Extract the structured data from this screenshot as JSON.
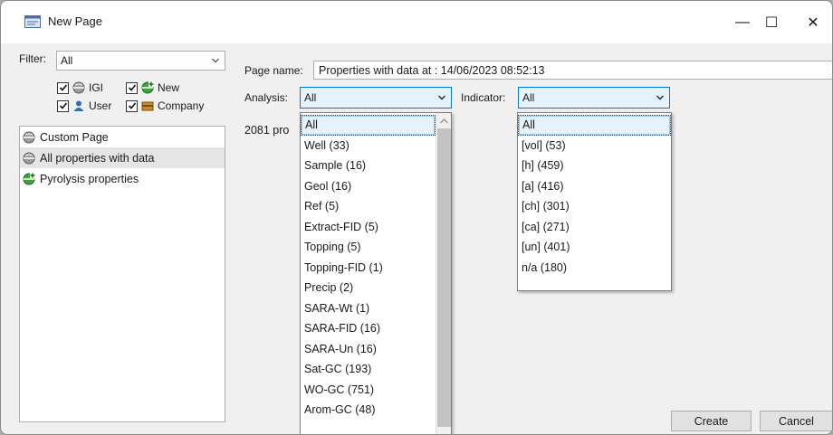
{
  "window": {
    "title": "New Page",
    "minimize_glyph": "—",
    "maximize_glyph": "☐",
    "close_glyph": "✕"
  },
  "filter": {
    "label": "Filter:",
    "value": "All",
    "checkboxes": [
      {
        "label": "IGI",
        "checked": true,
        "icon": "igi-icon"
      },
      {
        "label": "New",
        "checked": true,
        "icon": "new-icon"
      },
      {
        "label": "User",
        "checked": true,
        "icon": "user-icon"
      },
      {
        "label": "Company",
        "checked": true,
        "icon": "company-icon"
      }
    ]
  },
  "templates": {
    "items": [
      {
        "label": "Custom Page",
        "icon": "igi-icon"
      },
      {
        "label": "All properties with data",
        "icon": "igi-icon",
        "selected": true
      },
      {
        "label": "Pyrolysis properties",
        "icon": "new-icon"
      }
    ]
  },
  "page_name": {
    "label": "Page name:",
    "value": "Properties with data at : 14/06/2023 08:52:13"
  },
  "analysis": {
    "label": "Analysis:",
    "value": "All",
    "options": [
      "All",
      "Well (33)",
      "Sample (16)",
      "Geol (16)",
      "Ref (5)",
      "Extract-FID (5)",
      "Topping (5)",
      "Topping-FID (1)",
      "Precip (2)",
      "SARA-Wt (1)",
      "SARA-FID (16)",
      "SARA-Un (16)",
      "Sat-GC (193)",
      "WO-GC (751)",
      "Arom-GC (48)"
    ]
  },
  "indicator": {
    "label": "Indicator:",
    "value": "All",
    "options": [
      "All",
      "[vol] (53)",
      "[h] (459)",
      "[a] (416)",
      "[ch] (301)",
      "[ca] (271)",
      "[un] (401)",
      "n/a (180)"
    ]
  },
  "count_text": "2081 pro",
  "buttons": {
    "create": "Create",
    "cancel": "Cancel"
  },
  "colors": {
    "accent": "#0078d4",
    "selected_bg": "#e5f1fb"
  }
}
